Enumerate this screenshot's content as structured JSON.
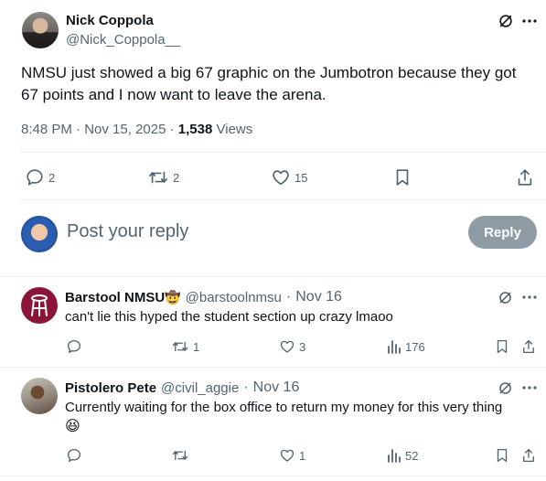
{
  "main_tweet": {
    "author_name": "Nick Coppola",
    "author_handle": "@Nick_Coppola__",
    "text": "NMSU just showed a big 67 graphic on the Jumbotron because they got 67 points and I now want to leave the arena.",
    "time": "8:48 PM",
    "date": "Nov 15, 2025",
    "views_count": "1,538",
    "views_label": "Views",
    "replies": "2",
    "reposts": "2",
    "likes": "15"
  },
  "reply_box": {
    "placeholder": "Post your reply",
    "button_label": "Reply"
  },
  "replies": [
    {
      "author_name": "Barstool NMSU",
      "author_emoji": "🤠",
      "author_handle": "@barstoolnmsu",
      "date": "Nov 16",
      "text": "can't lie this hyped the student section up crazy lmaoo",
      "replies": "",
      "reposts": "1",
      "likes": "3",
      "views": "176"
    },
    {
      "author_name": "Pistolero Pete",
      "author_handle": "@civil_aggie",
      "date": "Nov 16",
      "text": "Currently waiting for the box office to return my money for this very thing",
      "emoji": "😆",
      "replies": "",
      "reposts": "",
      "likes": "1",
      "views": "52"
    }
  ],
  "separator": "·",
  "colors": {
    "text": "#0f1419",
    "muted": "#536471",
    "reply_button": "#8e9ba4",
    "barstool": "#8a1538",
    "divider": "#eff3f4"
  }
}
